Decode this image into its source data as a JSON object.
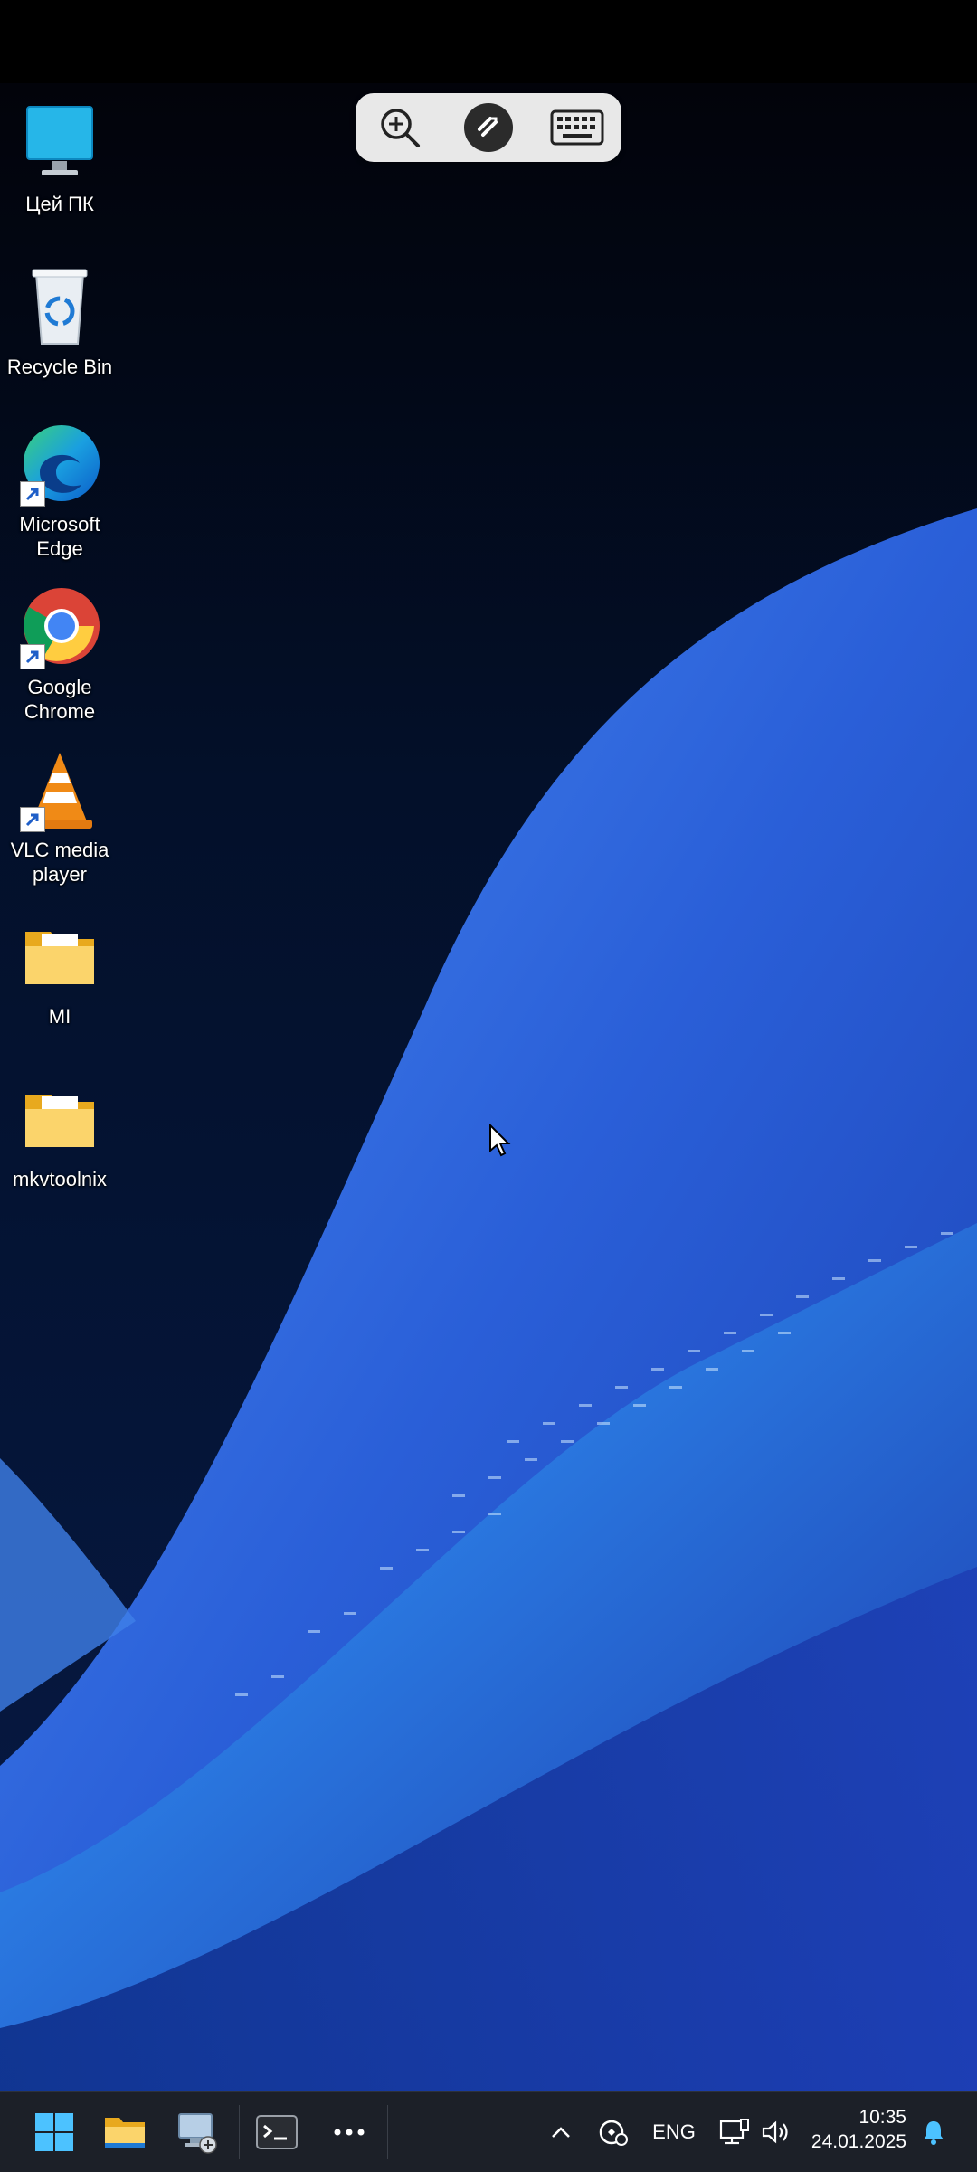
{
  "desktop_icons": [
    {
      "label": "Цей ПК",
      "icon": "this-pc-icon"
    },
    {
      "label": "Recycle Bin",
      "icon": "recycle-bin-icon"
    },
    {
      "label": "Microsoft\nEdge",
      "icon": "microsoft-edge-icon"
    },
    {
      "label": "Google\nChrome",
      "icon": "google-chrome-icon"
    },
    {
      "label": "VLC media\nplayer",
      "icon": "vlc-icon"
    },
    {
      "label": "MI",
      "icon": "folder-icon"
    },
    {
      "label": "mkvtoolnix",
      "icon": "folder-icon"
    }
  ],
  "remote_toolbar": {
    "buttons": [
      "zoom-in-icon",
      "remote-connection-icon",
      "keyboard-icon"
    ]
  },
  "taskbar": {
    "apps": [
      "windows-start-icon",
      "file-explorer-icon",
      "remote-desktop-icon",
      "terminal-icon",
      "more-icon"
    ],
    "tray": {
      "language": "ENG",
      "time": "10:35",
      "date": "24.01.2025"
    }
  },
  "colors": {
    "taskbar_bg": "#1c2028",
    "wallpaper_accent": "#2f6fe8"
  }
}
